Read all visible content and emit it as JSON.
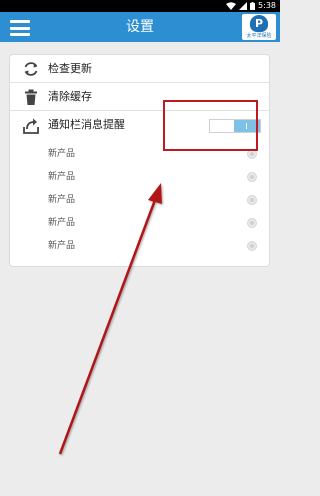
{
  "status_bar": {
    "time": "5:38"
  },
  "app_bar": {
    "title": "设置",
    "logo": {
      "mark": "P",
      "caption": "太平洋保险"
    }
  },
  "settings": {
    "check_update": "检查更新",
    "clear_cache": "清除缓存",
    "notification": {
      "label": "通知栏消息提醒",
      "enabled": true,
      "items": [
        {
          "label": "新产品"
        },
        {
          "label": "新产品"
        },
        {
          "label": "新产品"
        },
        {
          "label": "新产品"
        },
        {
          "label": "新产品"
        }
      ]
    }
  },
  "colors": {
    "app_bar": "#2d8fd2",
    "toggle_on": "#7ec1e6",
    "annotation": "#c0181f"
  },
  "icons": [
    "menu-icon",
    "wifi-icon",
    "signal-icon",
    "battery-icon",
    "refresh-icon",
    "trash-icon",
    "share-icon"
  ]
}
